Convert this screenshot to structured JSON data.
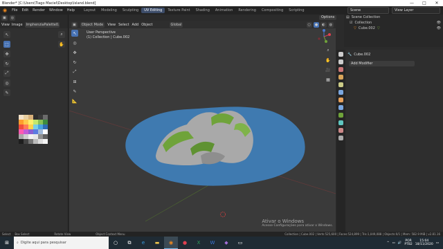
{
  "window": {
    "title": "Blender* [C:\\Users\\Tiago Maciel\\Desktop\\Island.blend]",
    "min": "—",
    "max": "□",
    "close": "✕"
  },
  "menu": [
    "File",
    "Edit",
    "Render",
    "Window",
    "Help"
  ],
  "workspaces": [
    {
      "label": "Layout",
      "active": false
    },
    {
      "label": "Modeling",
      "active": false
    },
    {
      "label": "Sculpting",
      "active": false
    },
    {
      "label": "UV Editing",
      "active": true
    },
    {
      "label": "Texture Paint",
      "active": false
    },
    {
      "label": "Shading",
      "active": false
    },
    {
      "label": "Animation",
      "active": false
    },
    {
      "label": "Rendering",
      "active": false
    },
    {
      "label": "Compositing",
      "active": false
    },
    {
      "label": "Scripting",
      "active": false
    }
  ],
  "scene": {
    "name": "Scene",
    "view_layer": "View Layer"
  },
  "image_editor": {
    "view": "View",
    "image": "Image",
    "image_name": "ImphenziaPalette0..."
  },
  "viewport": {
    "mode": "Object Mode",
    "menu": [
      "View",
      "Select",
      "Add",
      "Object"
    ],
    "global": "Global",
    "options": "Options",
    "info_line1": "User Perspective",
    "info_line2": "(1) Collection | Cube.002"
  },
  "outliner": {
    "root": "Scene Collection",
    "collection": "Collection",
    "object": "Cube.002"
  },
  "properties": {
    "object": "Cube.002",
    "add_modifier": "Add Modifier"
  },
  "watermark": {
    "line1": "Ativar o Windows",
    "line2": "Acesse Configurações para ativar o Windows."
  },
  "status": {
    "select": "Select",
    "box_select": "Box Select",
    "rotate": "Rotate View",
    "context": "Object Context Menu",
    "stats": "Collection | Cube.002 | Verts:525,600 | Faces:524,899 | Tris:1,049,088 | Objects:0/1 | Mem: 582.9 MiB | v2.81.16"
  },
  "taskbar": {
    "search_placeholder": "Digite aqui para pesquisar",
    "lang1": "POR",
    "lang2": "PTB2",
    "time": "15:04",
    "date": "18/11/2020"
  },
  "colors": {
    "accent": "#4772b3",
    "water": "#3f7ab0",
    "grass": "#6fa33a",
    "rock": "#b8b8b8"
  },
  "palette": [
    "#f3e2c8",
    "#e8cfa0",
    "#d8b07a",
    "#2d2d2d",
    "#3a3a3a",
    "#6b6b6b",
    "#ff9d2e",
    "#ffc94d",
    "#ffef6b",
    "#c5e86c",
    "#88c057",
    "#3d8b3d",
    "#f24d3d",
    "#ff7a59",
    "#ffd24d",
    "#7ad0e6",
    "#4aa3df",
    "#2f6cb5",
    "#ff5ab0",
    "#c45bd6",
    "#8a5fd1",
    "#5a7be0",
    "#9fb8d8",
    "#ffffff",
    "#a8a8a8",
    "#cfcfcf",
    "#f0f0f0",
    "#e7e7e7",
    "#909090",
    "#606060",
    "#1e1e1e",
    "#444444",
    "#777777",
    "#bbbbbb",
    "#dddddd",
    "#f5f5f5"
  ]
}
